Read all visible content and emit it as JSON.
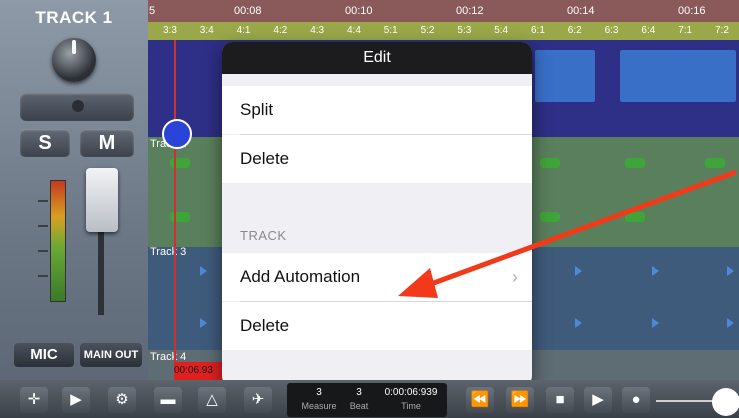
{
  "strip": {
    "track_title": "TRACK 1",
    "solo_label": "S",
    "mute_label": "M",
    "input_label": "MIC",
    "output_label": "MAIN OUT"
  },
  "ruler": {
    "times": [
      "5",
      "00:08",
      "00:10",
      "00:12",
      "00:14",
      "00:16"
    ],
    "beats": [
      "3:3",
      "3:4",
      "4:1",
      "4:2",
      "4:3",
      "4:4",
      "5:1",
      "5:2",
      "5:3",
      "5:4",
      "6:1",
      "6:2",
      "6:3",
      "6:4",
      "7:1",
      "7:2"
    ]
  },
  "tracks": {
    "track2": "Track 2",
    "track3": "Track 3",
    "track4": "Track 4"
  },
  "playhead_time": "00:06.93",
  "edit_menu": {
    "title": "Edit",
    "items": [
      "Split",
      "Delete"
    ],
    "section_header": "TRACK",
    "track_items": [
      "Add Automation",
      "Delete"
    ]
  },
  "counter": {
    "measure": "3",
    "beat": "3",
    "time": "0:00:06:939",
    "measure_label": "Measure",
    "beat_label": "Beat",
    "time_label": "Time"
  },
  "toolbar_icons": [
    "move-icon",
    "snap-icon",
    "gear-icon",
    "folder-icon",
    "metronome-icon",
    "plane-icon",
    "rewind-icon",
    "fast-forward-icon",
    "stop-icon",
    "play-icon",
    "record-icon"
  ],
  "colors": {
    "annotation_arrow": "#f23a1a",
    "playhead": "#d03030",
    "popup_header": "#1c1c1e"
  }
}
